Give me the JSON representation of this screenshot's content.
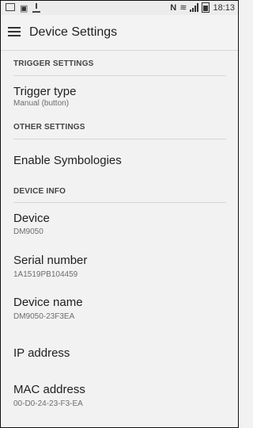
{
  "status": {
    "time": "18:13",
    "icons": [
      "notification-icon",
      "screenshot-icon",
      "download-icon",
      "nfc-icon",
      "wifi-icon",
      "signal-icon",
      "battery-icon"
    ]
  },
  "app": {
    "title": "Device Settings"
  },
  "sections": {
    "trigger": "TRIGGER SETTINGS",
    "other": "OTHER SETTINGS",
    "device_info": "DEVICE INFO"
  },
  "items": {
    "trigger_type": {
      "title": "Trigger type",
      "value": "Manual (button)"
    },
    "enable_symbologies": {
      "title": "Enable Symbologies"
    },
    "device": {
      "title": "Device",
      "value": "DM9050"
    },
    "serial_number": {
      "title": "Serial number",
      "value": "1A1519PB104459"
    },
    "device_name": {
      "title": "Device name",
      "value": "DM9050-23F3EA"
    },
    "ip_address": {
      "title": "IP address"
    },
    "mac_address": {
      "title": "MAC address",
      "value": "00-D0-24-23-F3-EA"
    }
  }
}
